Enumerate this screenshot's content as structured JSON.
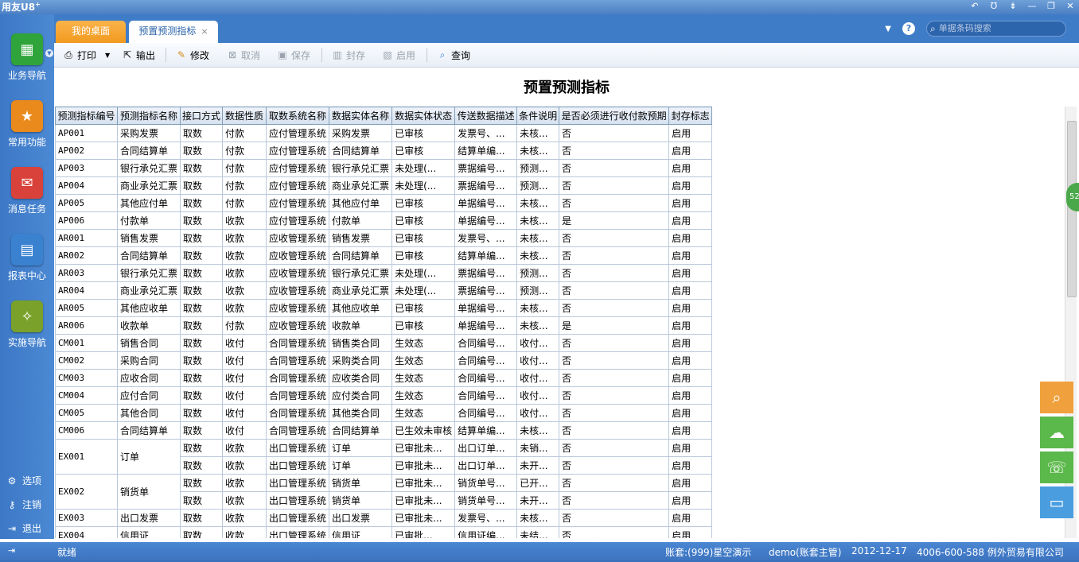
{
  "app": {
    "logo": "用友U8",
    "logo_sup": "+"
  },
  "window_controls": [
    "↶",
    "Ʊ",
    "⇟",
    "—",
    "❐",
    "✕"
  ],
  "nav": [
    {
      "label": "业务导航",
      "icon": "business-nav-icon",
      "color": "#2fa43a",
      "glyph": "▦"
    },
    {
      "label": "常用功能",
      "icon": "star-icon",
      "color": "#ea8a1c",
      "glyph": "★"
    },
    {
      "label": "消息任务",
      "icon": "message-icon",
      "color": "#d9423a",
      "glyph": "✉"
    },
    {
      "label": "报表中心",
      "icon": "report-icon",
      "color": "#3a82d0",
      "glyph": "▤"
    },
    {
      "label": "实施导航",
      "icon": "compass-icon",
      "color": "#7aa12a",
      "glyph": "✧"
    }
  ],
  "bottom_nav": [
    {
      "label": "选项",
      "glyph": "⚙"
    },
    {
      "label": "注销",
      "glyph": "⚷"
    },
    {
      "label": "退出",
      "glyph": "⇥"
    }
  ],
  "tabs": {
    "desktop": "我的桌面",
    "current": "预置预测指标",
    "close": "×"
  },
  "search": {
    "placeholder": "单据条码搜索"
  },
  "toolbar": {
    "print": "打印",
    "export": "输出",
    "edit": "修改",
    "cancel": "取消",
    "save": "保存",
    "seal": "封存",
    "enable": "启用",
    "query": "查询"
  },
  "page_title": "预置预测指标",
  "columns": [
    "预测指标编号",
    "预测指标名称",
    "接口方式",
    "数据性质",
    "取数系统名称",
    "数据实体名称",
    "数据实体状态",
    "传送数据描述",
    "条件说明",
    "是否必须进行收付款预期",
    "封存标志"
  ],
  "rows": [
    {
      "code": "AP001",
      "name": "采购发票",
      "iface": "取数",
      "nature": "付款",
      "system": "应付管理系统",
      "entity": "采购发票",
      "state": "已审核",
      "desc": "发票号、...",
      "cond": "未核...",
      "must": "否",
      "flag": "启用"
    },
    {
      "code": "AP002",
      "name": "合同结算单",
      "iface": "取数",
      "nature": "付款",
      "system": "应付管理系统",
      "entity": "合同结算单",
      "state": "已审核",
      "desc": "结算单编...",
      "cond": "未核...",
      "must": "否",
      "flag": "启用"
    },
    {
      "code": "AP003",
      "name": "银行承兑汇票",
      "iface": "取数",
      "nature": "付款",
      "system": "应付管理系统",
      "entity": "银行承兑汇票",
      "state": "未处理(...",
      "desc": "票据编号...",
      "cond": "预测...",
      "must": "否",
      "flag": "启用"
    },
    {
      "code": "AP004",
      "name": "商业承兑汇票",
      "iface": "取数",
      "nature": "付款",
      "system": "应付管理系统",
      "entity": "商业承兑汇票",
      "state": "未处理(...",
      "desc": "票据编号...",
      "cond": "预测...",
      "must": "否",
      "flag": "启用"
    },
    {
      "code": "AP005",
      "name": "其他应付单",
      "iface": "取数",
      "nature": "付款",
      "system": "应付管理系统",
      "entity": "其他应付单",
      "state": "已审核",
      "desc": "单据编号...",
      "cond": "未核...",
      "must": "否",
      "flag": "启用"
    },
    {
      "code": "AP006",
      "name": "付款单",
      "iface": "取数",
      "nature": "收款",
      "system": "应付管理系统",
      "entity": "付款单",
      "state": "已审核",
      "desc": "单据编号...",
      "cond": "未核...",
      "must": "是",
      "flag": "启用"
    },
    {
      "code": "AR001",
      "name": "销售发票",
      "iface": "取数",
      "nature": "收款",
      "system": "应收管理系统",
      "entity": "销售发票",
      "state": "已审核",
      "desc": "发票号、...",
      "cond": "未核...",
      "must": "否",
      "flag": "启用"
    },
    {
      "code": "AR002",
      "name": "合同结算单",
      "iface": "取数",
      "nature": "收款",
      "system": "应收管理系统",
      "entity": "合同结算单",
      "state": "已审核",
      "desc": "结算单编...",
      "cond": "未核...",
      "must": "否",
      "flag": "启用"
    },
    {
      "code": "AR003",
      "name": "银行承兑汇票",
      "iface": "取数",
      "nature": "收款",
      "system": "应收管理系统",
      "entity": "银行承兑汇票",
      "state": "未处理(...",
      "desc": "票据编号...",
      "cond": "预测...",
      "must": "否",
      "flag": "启用"
    },
    {
      "code": "AR004",
      "name": "商业承兑汇票",
      "iface": "取数",
      "nature": "收款",
      "system": "应收管理系统",
      "entity": "商业承兑汇票",
      "state": "未处理(...",
      "desc": "票据编号...",
      "cond": "预测...",
      "must": "否",
      "flag": "启用"
    },
    {
      "code": "AR005",
      "name": "其他应收单",
      "iface": "取数",
      "nature": "收款",
      "system": "应收管理系统",
      "entity": "其他应收单",
      "state": "已审核",
      "desc": "单据编号...",
      "cond": "未核...",
      "must": "否",
      "flag": "启用"
    },
    {
      "code": "AR006",
      "name": "收款单",
      "iface": "取数",
      "nature": "付款",
      "system": "应收管理系统",
      "entity": "收款单",
      "state": "已审核",
      "desc": "单据编号...",
      "cond": "未核...",
      "must": "是",
      "flag": "启用"
    },
    {
      "code": "CM001",
      "name": "销售合同",
      "iface": "取数",
      "nature": "收付",
      "system": "合同管理系统",
      "entity": "销售类合同",
      "state": "生效态",
      "desc": "合同编号...",
      "cond": "收付...",
      "must": "否",
      "flag": "启用"
    },
    {
      "code": "CM002",
      "name": "采购合同",
      "iface": "取数",
      "nature": "收付",
      "system": "合同管理系统",
      "entity": "采购类合同",
      "state": "生效态",
      "desc": "合同编号...",
      "cond": "收付...",
      "must": "否",
      "flag": "启用"
    },
    {
      "code": "CM003",
      "name": "应收合同",
      "iface": "取数",
      "nature": "收付",
      "system": "合同管理系统",
      "entity": "应收类合同",
      "state": "生效态",
      "desc": "合同编号...",
      "cond": "收付...",
      "must": "否",
      "flag": "启用"
    },
    {
      "code": "CM004",
      "name": "应付合同",
      "iface": "取数",
      "nature": "收付",
      "system": "合同管理系统",
      "entity": "应付类合同",
      "state": "生效态",
      "desc": "合同编号...",
      "cond": "收付...",
      "must": "否",
      "flag": "启用"
    },
    {
      "code": "CM005",
      "name": "其他合同",
      "iface": "取数",
      "nature": "收付",
      "system": "合同管理系统",
      "entity": "其他类合同",
      "state": "生效态",
      "desc": "合同编号...",
      "cond": "收付...",
      "must": "否",
      "flag": "启用"
    },
    {
      "code": "CM006",
      "name": "合同结算单",
      "iface": "取数",
      "nature": "收付",
      "system": "合同管理系统",
      "entity": "合同结算单",
      "state": "已生效未审核",
      "desc": "结算单编...",
      "cond": "未核...",
      "must": "否",
      "flag": "启用"
    },
    {
      "code": "EX001",
      "name": "订单",
      "iface": "取数",
      "nature": "收款",
      "system": "出口管理系统",
      "entity": "订单",
      "state": "已审批未...",
      "desc": "出口订单...",
      "cond": "未销...",
      "must": "否",
      "flag": "启用",
      "span": 2
    },
    {
      "code": "",
      "name": "",
      "iface": "取数",
      "nature": "收款",
      "system": "出口管理系统",
      "entity": "订单",
      "state": "已审批未...",
      "desc": "出口订单...",
      "cond": "未开...",
      "must": "否",
      "flag": "启用",
      "merged": true
    },
    {
      "code": "EX002",
      "name": "销货单",
      "iface": "取数",
      "nature": "收款",
      "system": "出口管理系统",
      "entity": "销货单",
      "state": "已审批未...",
      "desc": "销货单号...",
      "cond": "已开...",
      "must": "否",
      "flag": "启用",
      "span": 2
    },
    {
      "code": "",
      "name": "",
      "iface": "取数",
      "nature": "收款",
      "system": "出口管理系统",
      "entity": "销货单",
      "state": "已审批未...",
      "desc": "销货单号...",
      "cond": "未开...",
      "must": "否",
      "flag": "启用",
      "merged": true
    },
    {
      "code": "EX003",
      "name": "出口发票",
      "iface": "取数",
      "nature": "收款",
      "system": "出口管理系统",
      "entity": "出口发票",
      "state": "已审批未...",
      "desc": "发票号、...",
      "cond": "未核...",
      "must": "否",
      "flag": "启用"
    },
    {
      "code": "EX004",
      "name": "信用证",
      "iface": "取数",
      "nature": "收款",
      "system": "出口管理系统",
      "entity": "信用证",
      "state": "已审批...",
      "desc": "信用证编...",
      "cond": "未结...",
      "must": "否",
      "flag": "启用"
    }
  ],
  "badge": "52",
  "status": {
    "ready": "就绪",
    "account": "账套:(999)星空演示",
    "user": "demo(账套主管)",
    "date": "2012-12-17",
    "phone": "4006-600-588 例外贸易有限公司"
  }
}
